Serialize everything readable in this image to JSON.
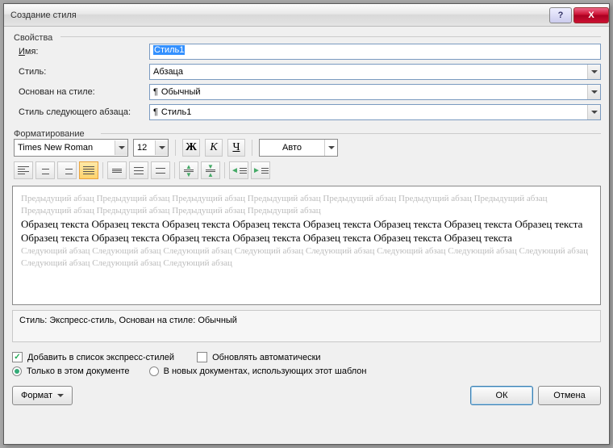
{
  "title": "Создание стиля",
  "groups": {
    "props": "Свойства",
    "format": "Форматирование"
  },
  "labels": {
    "name": "Имя:",
    "style": "Стиль:",
    "based": "Основан на стиле:",
    "next": "Стиль следующего абзаца:"
  },
  "values": {
    "name": "Стиль1",
    "style": "Абзаца",
    "based": "Обычный",
    "next": "Стиль1",
    "font": "Times New Roman",
    "size": "12",
    "color": "Авто"
  },
  "preview": {
    "prev": "Предыдущий абзац Предыдущий абзац Предыдущий абзац Предыдущий абзац Предыдущий абзац Предыдущий абзац Предыдущий абзац Предыдущий абзац Предыдущий абзац Предыдущий абзац Предыдущий абзац",
    "sample": "Образец текста Образец текста Образец текста Образец текста Образец текста Образец текста Образец текста Образец текста Образец текста Образец текста Образец текста Образец текста Образец текста Образец текста Образец текста",
    "next": "Следующий абзац Следующий абзац Следующий абзац Следующий абзац Следующий абзац Следующий абзац Следующий абзац Следующий абзац Следующий абзац Следующий абзац Следующий абзац"
  },
  "desc": "Стиль: Экспресс-стиль, Основан на стиле: Обычный",
  "checks": {
    "addQuick": "Добавить в список экспресс-стилей",
    "autoUpdate": "Обновлять автоматически"
  },
  "radios": {
    "thisDoc": "Только в этом документе",
    "newDocs": "В новых документах, использующих этот шаблон"
  },
  "buttons": {
    "format": "Формат",
    "ok": "ОК",
    "cancel": "Отмена",
    "help": "?",
    "close": "X"
  },
  "glyphs": {
    "pilcrow": "¶"
  }
}
